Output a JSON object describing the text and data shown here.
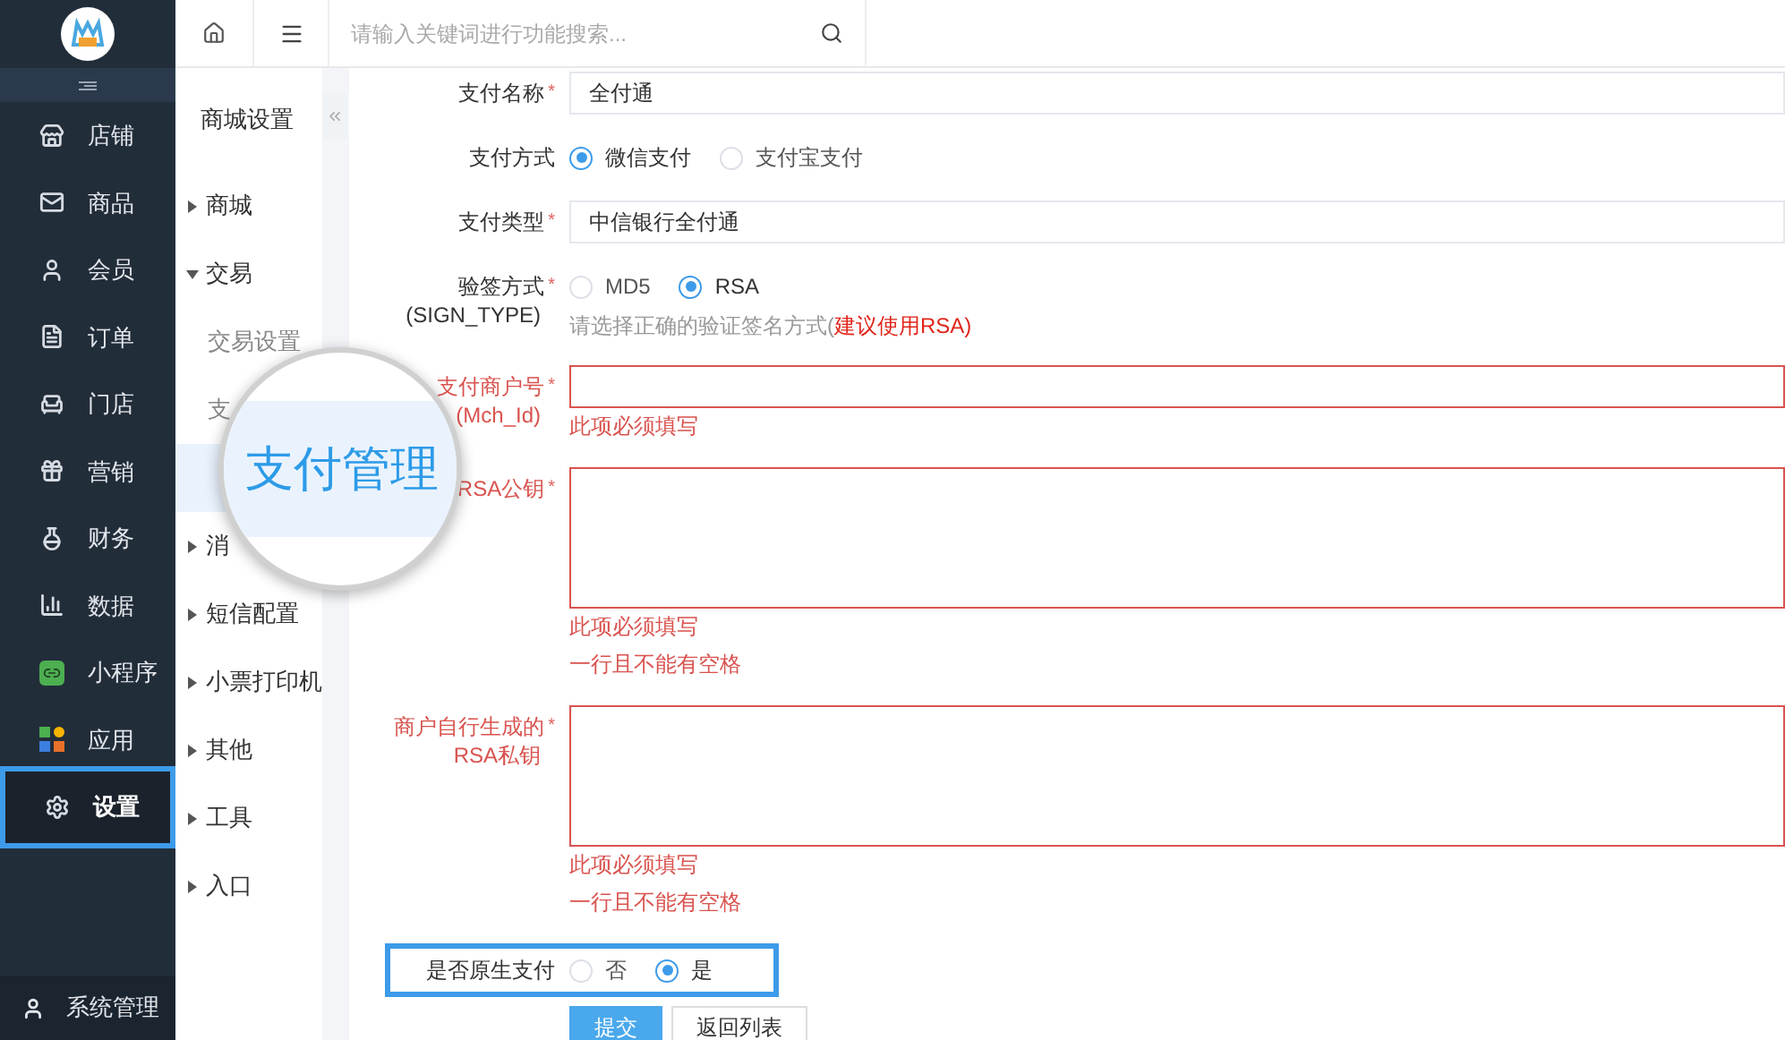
{
  "sidebar": {
    "items": [
      {
        "label": "店铺",
        "selected": false,
        "highlighted": false
      },
      {
        "label": "商品",
        "selected": false,
        "highlighted": false
      },
      {
        "label": "会员",
        "selected": false,
        "highlighted": false
      },
      {
        "label": "订单",
        "selected": false,
        "highlighted": false
      },
      {
        "label": "门店",
        "selected": false,
        "highlighted": false
      },
      {
        "label": "营销",
        "selected": false,
        "highlighted": false
      },
      {
        "label": "财务",
        "selected": false,
        "highlighted": false
      },
      {
        "label": "数据",
        "selected": false,
        "highlighted": false
      },
      {
        "label": "小程序",
        "selected": false,
        "highlighted": false
      },
      {
        "label": "应用",
        "selected": false,
        "highlighted": false
      },
      {
        "label": "设置",
        "selected": true,
        "highlighted": true
      }
    ],
    "footer": {
      "label": "系统管理"
    }
  },
  "topbar": {
    "search": {
      "placeholder": "请输入关键词进行功能搜索..."
    }
  },
  "submenu": {
    "title": "商城设置",
    "groups": [
      {
        "label": "商城",
        "expanded": false
      },
      {
        "label": "交易",
        "expanded": true,
        "children": [
          {
            "label": "交易设置",
            "selected": false
          },
          {
            "label": "支",
            "selected": false
          },
          {
            "selected": true
          }
        ]
      },
      {
        "label": "消",
        "expanded": false
      },
      {
        "label": "短信配置",
        "expanded": false
      },
      {
        "label": "小票打印机",
        "expanded": false
      },
      {
        "label": "其他",
        "expanded": false
      },
      {
        "label": "工具",
        "expanded": false
      },
      {
        "label": "入口",
        "expanded": false
      }
    ]
  },
  "magnifier": {
    "text": "支付管理"
  },
  "form": {
    "fields": [
      {
        "kind": "text",
        "label": "支付名称",
        "required_mark": "*",
        "error": false,
        "value": "全付通"
      },
      {
        "kind": "radio",
        "label": "支付方式",
        "options": [
          {
            "label": "微信支付",
            "selected": true
          },
          {
            "label": "支付宝支付",
            "selected": false
          }
        ]
      },
      {
        "kind": "text",
        "label": "支付类型",
        "required_mark": "*",
        "error": false,
        "value": "中信银行全付通"
      },
      {
        "kind": "radio",
        "label": "验签方式",
        "sublabel": "(SIGN_TYPE)",
        "required_mark": "*",
        "options": [
          {
            "label": "MD5",
            "selected": false
          },
          {
            "label": "RSA",
            "selected": true
          }
        ],
        "hint": [
          {
            "text": "请选择正确的验证签名方式(",
            "emphasis": false
          },
          {
            "text": "建议使用RSA)",
            "emphasis": true
          }
        ]
      },
      {
        "kind": "text",
        "label": "支付商户号",
        "sublabel": "(Mch_Id)",
        "required_mark": "*",
        "error": true,
        "errors": [
          "此项必须填写"
        ]
      },
      {
        "kind": "textarea",
        "label": "RSA公钥",
        "required_mark": "*",
        "error": true,
        "errors": [
          "此项必须填写",
          "一行且不能有空格"
        ]
      },
      {
        "kind": "textarea",
        "label": "商户自行生成的",
        "sublabel": "RSA私钥",
        "required_mark": "*",
        "error": true,
        "errors": [
          "此项必须填写",
          "一行且不能有空格"
        ]
      },
      {
        "kind": "radio",
        "label": "是否原生支付",
        "highlighted": true,
        "options": [
          {
            "label": "否",
            "selected": false
          },
          {
            "label": "是",
            "selected": true
          }
        ]
      }
    ],
    "buttons": [
      {
        "label": "提交",
        "kind": "primary"
      },
      {
        "label": "返回列表",
        "kind": "default"
      }
    ]
  }
}
